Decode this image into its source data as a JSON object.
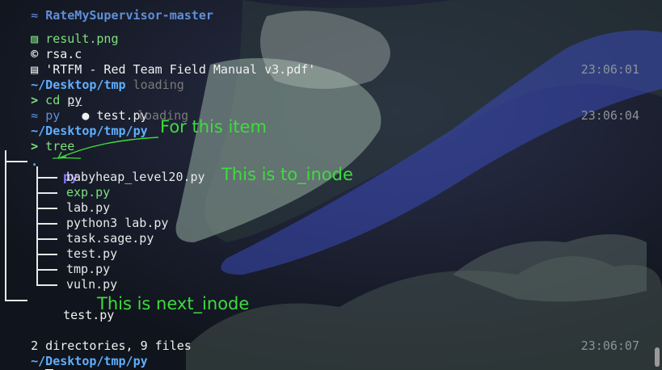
{
  "lines": {
    "l0": {
      "icon": "≈",
      "name": "RateMySupervisor-master"
    },
    "l1": {
      "icon": "▨",
      "name": "result.png"
    },
    "l2": {
      "icon": "©",
      "name": "rsa.c"
    },
    "l3": {
      "icon": "▤",
      "name": "'RTFM - Red Team Field Manual v3.pdf'"
    },
    "l4": {
      "path_prefix": "~/Desktop/",
      "path_dir": "tmp",
      "ghost": " loading",
      "time": "23:06:01"
    },
    "l5": {
      "prompt": ">",
      "cmd": " cd ",
      "arg": "py"
    },
    "l6": {
      "icon": "≈",
      "dir": "py",
      "file_icon": "●",
      "file": "test.py",
      "ghost": "loading"
    },
    "l7": {
      "path_prefix": "~/Desktop/tmp/",
      "path_dir": "py",
      "ghost": " loading",
      "time": "23:06:04"
    },
    "l8": {
      "prompt": ">",
      "cmd": " tree"
    },
    "l9": {
      "dot": "."
    },
    "l10": {
      "dir": "py"
    },
    "files": [
      "babyheap_level20.py",
      "exp.py",
      "lab.py",
      "python3 lab.py",
      "task.sage.py",
      "test.py",
      "tmp.py",
      "vuln.py"
    ],
    "l19": {
      "file": "test.py"
    },
    "l21": {
      "summary": "2 directories, 9 files"
    },
    "l22": {
      "path_prefix": "~/Desktop/tmp/",
      "path_dir": "py",
      "time": "23:06:07"
    },
    "l23": {
      "prompt": ">"
    }
  },
  "annotations": {
    "a1": "For this item",
    "a2": "This is to_inode",
    "a3": "This is next_inode"
  },
  "colors": {
    "annotation": "#3ddc3d",
    "prompt": "#7ee07e",
    "dir": "#8a7aff",
    "path": "#5fafff",
    "time": "#8a9399"
  }
}
